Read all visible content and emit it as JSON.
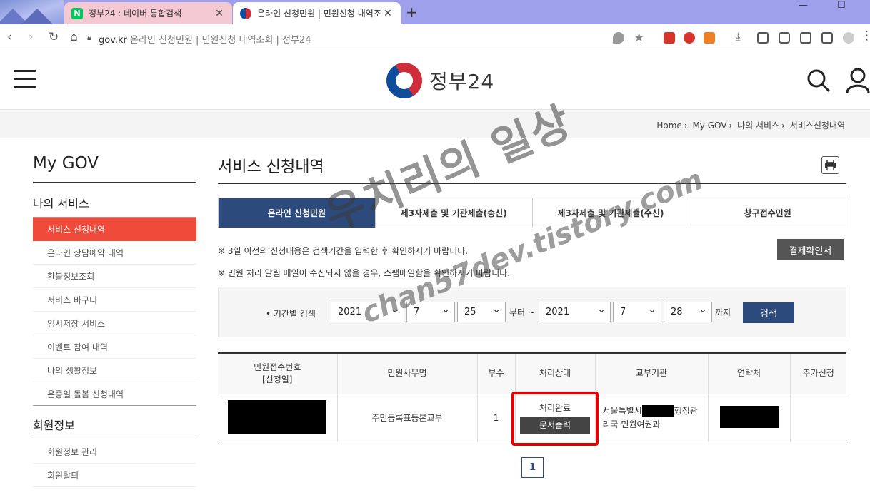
{
  "browser": {
    "tabs": [
      {
        "favicon": "N",
        "title": "정부24 : 네이버 통합검색"
      },
      {
        "favicon": "",
        "title": "온라인 신청민원 | 민원신청 내역조"
      }
    ],
    "url_domain": "gov.kr",
    "url_title": "온라인 신청민원 | 민원신청 내역조회 | 정부24"
  },
  "header": {
    "logo_text": "정부24"
  },
  "breadcrumb": [
    "Home",
    "My GOV",
    "나의 서비스",
    "서비스신청내역"
  ],
  "sidebar": {
    "title": "My GOV",
    "section1": "나의 서비스",
    "items1": [
      "서비스 신청내역",
      "온라인 상담예약 내역",
      "환불정보조회",
      "서비스 바구니",
      "임시저장 서비스",
      "이벤트 참여 내역",
      "나의 생활정보",
      "온종일 돌봄 신청내역"
    ],
    "section2": "회원정보",
    "items2": [
      "회원정보 관리",
      "회원탈퇴"
    ]
  },
  "main": {
    "title": "서비스 신청내역",
    "tabs": [
      "온라인 신청민원",
      "제3자제출 및 기관제출(송신)",
      "제3자제출 및 기관제출(수신)",
      "창구접수민원"
    ],
    "note1": "※ 3일 이전의 신청내용은 검색기간을 입력한 후 확인하시기 바랍니다.",
    "note2": "※ 민원 처리 알림 메일이 수신되지 않을 경우, 스팸메일함을 확인하시기 바랍니다.",
    "receipt_button": "결제확인서",
    "search": {
      "label": "• 기간별 검색",
      "from_year": "2021",
      "from_month": "7",
      "from_day": "25",
      "from_text": "부터 ~",
      "to_year": "2021",
      "to_month": "7",
      "to_day": "28",
      "to_text": "까지",
      "button": "검색"
    },
    "table": {
      "headers": [
        "민원접수번호",
        "[신청일]",
        "민원사무명",
        "부수",
        "처리상태",
        "교부기관",
        "연락처",
        "추가신청"
      ],
      "row": {
        "service": "주민등록표등본교부",
        "copies": "1",
        "status": "처리완료",
        "print_button": "문서출력",
        "agency_line1": "서울특별시",
        "agency_line1b": "행정관",
        "agency_line2": "리국 민원여권과"
      }
    },
    "page": "1"
  },
  "watermark": {
    "line1": "우치리의 일상",
    "line2": "chan57dev.tistory.com"
  }
}
